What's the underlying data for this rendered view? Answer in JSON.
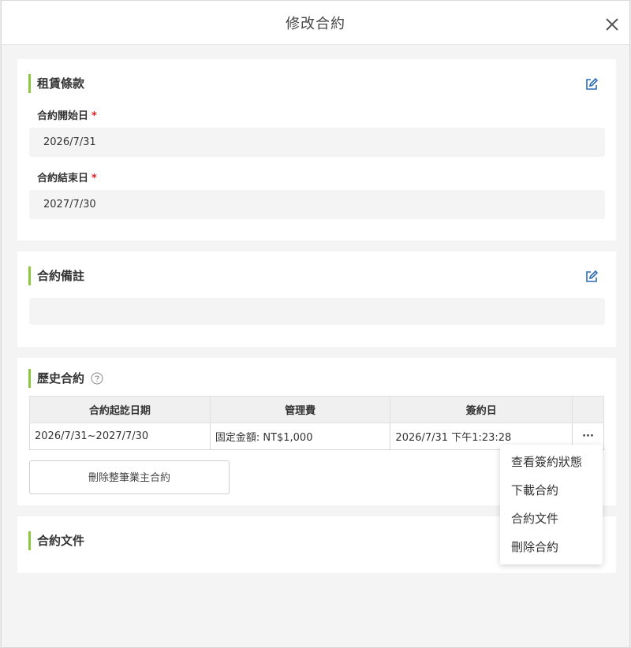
{
  "modal": {
    "title": "修改合約"
  },
  "lease_terms": {
    "title": "租賃條款",
    "start_label": "合約開始日",
    "start_value": "2026/7/31",
    "end_label": "合約結束日",
    "end_value": "2027/7/30",
    "required_mark": "*"
  },
  "remarks": {
    "title": "合約備註",
    "value": ""
  },
  "history": {
    "title": "歷史合約",
    "columns": [
      "合約起訖日期",
      "管理費",
      "簽約日"
    ],
    "rows": [
      {
        "period": "2026/7/31~2027/7/30",
        "fee": "固定金額: NT$1,000",
        "signed": "2026/7/31 下午1:23:28",
        "more": "···"
      }
    ],
    "delete_button": "刪除整筆業主合約"
  },
  "documents": {
    "title": "合約文件"
  },
  "dropdown": {
    "items": [
      "查看簽約狀態",
      "下載合約",
      "合約文件",
      "刪除合約"
    ]
  },
  "colors": {
    "accent_bar": "#8dc63f",
    "edit_icon": "#2b6cb8",
    "required": "#e02020"
  },
  "icons": {
    "close": "close-icon",
    "edit": "edit-icon",
    "help": "question-circle-icon"
  }
}
